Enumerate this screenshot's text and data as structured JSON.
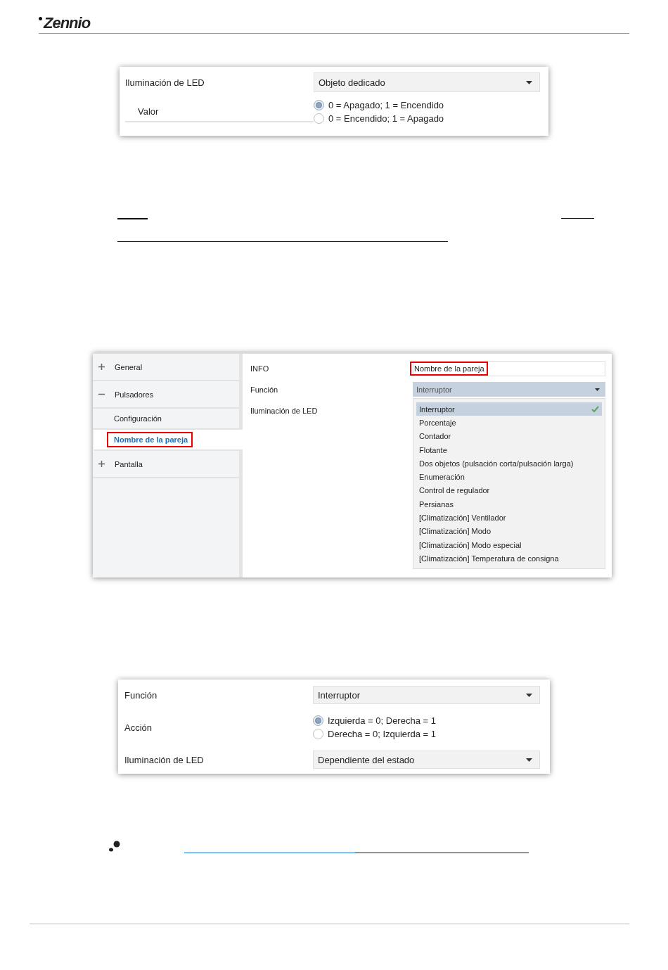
{
  "header": {
    "logo": "Zennio"
  },
  "panel_1": {
    "rows": [
      {
        "kind": "dropdown",
        "label": "Iluminación de LED",
        "value": "Objeto dedicado",
        "children": [
          {
            "kind": "radio",
            "label": "Valor",
            "options": [
              {
                "label": "0 = Apagado; 1 = Encendido",
                "selected": true
              },
              {
                "label": "0 = Encendido; 1 = Apagado",
                "selected": false
              }
            ]
          }
        ]
      }
    ]
  },
  "panel_2": {
    "sidebar": {
      "items": [
        {
          "label": "General",
          "expanded": false
        },
        {
          "label": "Pulsadores",
          "expanded": true,
          "children": [
            {
              "label": "Configuración",
              "selected": false,
              "highlighted": false
            },
            {
              "label": "Nombre de la pareja",
              "selected": true,
              "highlighted": true
            }
          ]
        },
        {
          "label": "Pantalla",
          "expanded": false
        }
      ]
    },
    "fields": [
      {
        "kind": "text",
        "label": "INFO",
        "value": "Nombre de la pareja",
        "highlighted": true
      },
      {
        "kind": "dropdown",
        "label": "Función",
        "value": "Interruptor",
        "expanded": true,
        "options": [
          {
            "label": "Interruptor",
            "selected": true
          },
          {
            "label": "Porcentaje",
            "selected": false
          },
          {
            "label": "Contador",
            "selected": false
          },
          {
            "label": "Flotante",
            "selected": false
          },
          {
            "label": "Dos objetos (pulsación corta/pulsación larga)",
            "selected": false
          },
          {
            "label": "Enumeración",
            "selected": false
          },
          {
            "label": "Control de regulador",
            "selected": false
          },
          {
            "label": "Persianas",
            "selected": false
          },
          {
            "label": "[Climatización] Ventilador",
            "selected": false
          },
          {
            "label": "[Climatización] Modo",
            "selected": false
          },
          {
            "label": "[Climatización] Modo especial",
            "selected": false
          },
          {
            "label": "[Climatización] Temperatura de consigna",
            "selected": false
          }
        ]
      },
      {
        "kind": "label",
        "label": "Iluminación de LED"
      }
    ]
  },
  "panel_3": {
    "rows": [
      {
        "kind": "dropdown",
        "label": "Función",
        "value": "Interruptor"
      },
      {
        "kind": "radio",
        "label": "Acción",
        "options": [
          {
            "label": "Izquierda = 0; Derecha = 1",
            "selected": true
          },
          {
            "label": "Derecha = 0; Izquierda = 1",
            "selected": false
          }
        ]
      },
      {
        "kind": "dropdown",
        "label": "Iluminación de LED",
        "value": "Dependiente del estado"
      }
    ]
  }
}
